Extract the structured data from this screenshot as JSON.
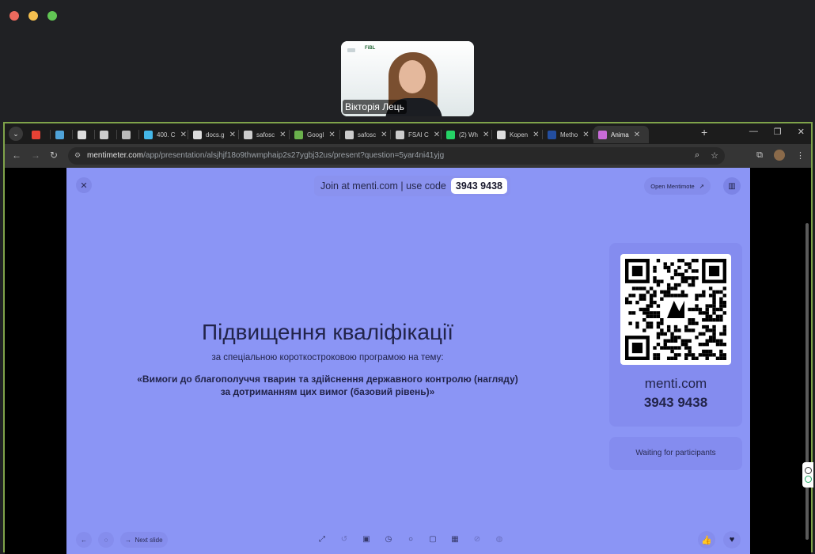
{
  "meeting": {
    "participant_name": "Вікторія Лець",
    "video_logo": "FiBL"
  },
  "browser": {
    "tabs": [
      {
        "label": "",
        "icon": "gmail-icon",
        "color": "#e94235"
      },
      {
        "label": "",
        "icon": "cloud-icon",
        "color": "#4fa3d9"
      },
      {
        "label": "",
        "icon": "id-card-icon",
        "color": "#dddddd"
      },
      {
        "label": "",
        "icon": "puzzle-icon",
        "color": "#cccccc"
      },
      {
        "label": "",
        "icon": "gear-app-icon",
        "color": "#bbbbbb"
      },
      {
        "label": "400. C",
        "icon": "cube-icon",
        "color": "#44b7e8"
      },
      {
        "label": "docs.g",
        "icon": "doc-icon",
        "color": "#dddddd"
      },
      {
        "label": "safosc",
        "icon": "page-icon",
        "color": "#cccccc"
      },
      {
        "label": "Googl",
        "icon": "leaf-icon",
        "color": "#6ab04c"
      },
      {
        "label": "safosc",
        "icon": "page-icon",
        "color": "#cccccc"
      },
      {
        "label": "FSAI C",
        "icon": "globe-icon",
        "color": "#cccccc"
      },
      {
        "label": "(2) Wh",
        "icon": "whatsapp-icon",
        "color": "#25d366"
      },
      {
        "label": "Kopen",
        "icon": "chatgpt-icon",
        "color": "#dddddd"
      },
      {
        "label": "Metho",
        "icon": "eu-flag-icon",
        "color": "#234ea0"
      },
      {
        "label": "Anima",
        "icon": "menti-icon",
        "color": "#c86bd8"
      }
    ],
    "new_tab": "+",
    "url_host": "mentimeter.com",
    "url_path": "/app/presentation/alsjhjf18o9thwmphaip2s27ygbj32us/present?question=5yar4ni41yjg"
  },
  "slide": {
    "join_text": "Join at menti.com | use code",
    "join_code": "3943 9438",
    "open_mentimote": "Open Mentimote",
    "menti_mark": "m",
    "title": "Підвищення кваліфікації",
    "subtitle": "за спеціальною короткостроковою програмою на тему:",
    "topic_line1": "«Вимоги до благополуччя тварин та здійснення державного контролю (нагляду)",
    "topic_line2": "за дотриманням цих вимог (базовий рівень)»",
    "menti_url": "menti.com",
    "menti_code": "3943 9438",
    "waiting": "Waiting for participants",
    "next_slide": "Next slide",
    "accent_color": "#8b95f5"
  }
}
